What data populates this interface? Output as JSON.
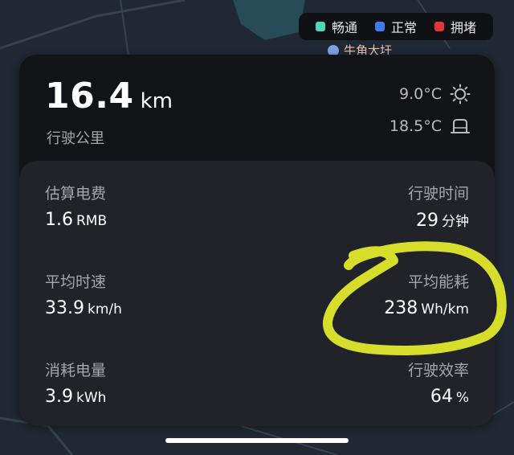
{
  "legend": {
    "items": [
      {
        "label": "畅通",
        "color": "#4fd6b5"
      },
      {
        "label": "正常",
        "color": "#3d7cf0"
      },
      {
        "label": "拥堵",
        "color": "#e3343c"
      }
    ]
  },
  "map": {
    "poi_label": "牛角大圩"
  },
  "trip": {
    "distance_value": "16.4",
    "distance_unit": "km",
    "distance_label": "行驶公里",
    "outside_temp": "9.0°C",
    "outside_icon": "sun-icon",
    "inside_temp": "18.5°C",
    "inside_icon": "car-seat-icon"
  },
  "stats": {
    "cost_label": "估算电费",
    "cost_value": "1.6",
    "cost_unit": "RMB",
    "time_label": "行驶时间",
    "time_value": "29",
    "time_unit": "分钟",
    "speed_label": "平均时速",
    "speed_value": "33.9",
    "speed_unit": "km/h",
    "consumption_label": "平均能耗",
    "consumption_value": "238",
    "consumption_unit": "Wh/km",
    "energy_label": "消耗电量",
    "energy_value": "3.9",
    "energy_unit": "kWh",
    "efficiency_label": "行驶效率",
    "efficiency_value": "64",
    "efficiency_unit": "%"
  },
  "colors": {
    "background_map": "#1f2833",
    "card_top": "#121316",
    "card_bottom": "#212328",
    "highlight": "#e6ee2a"
  }
}
